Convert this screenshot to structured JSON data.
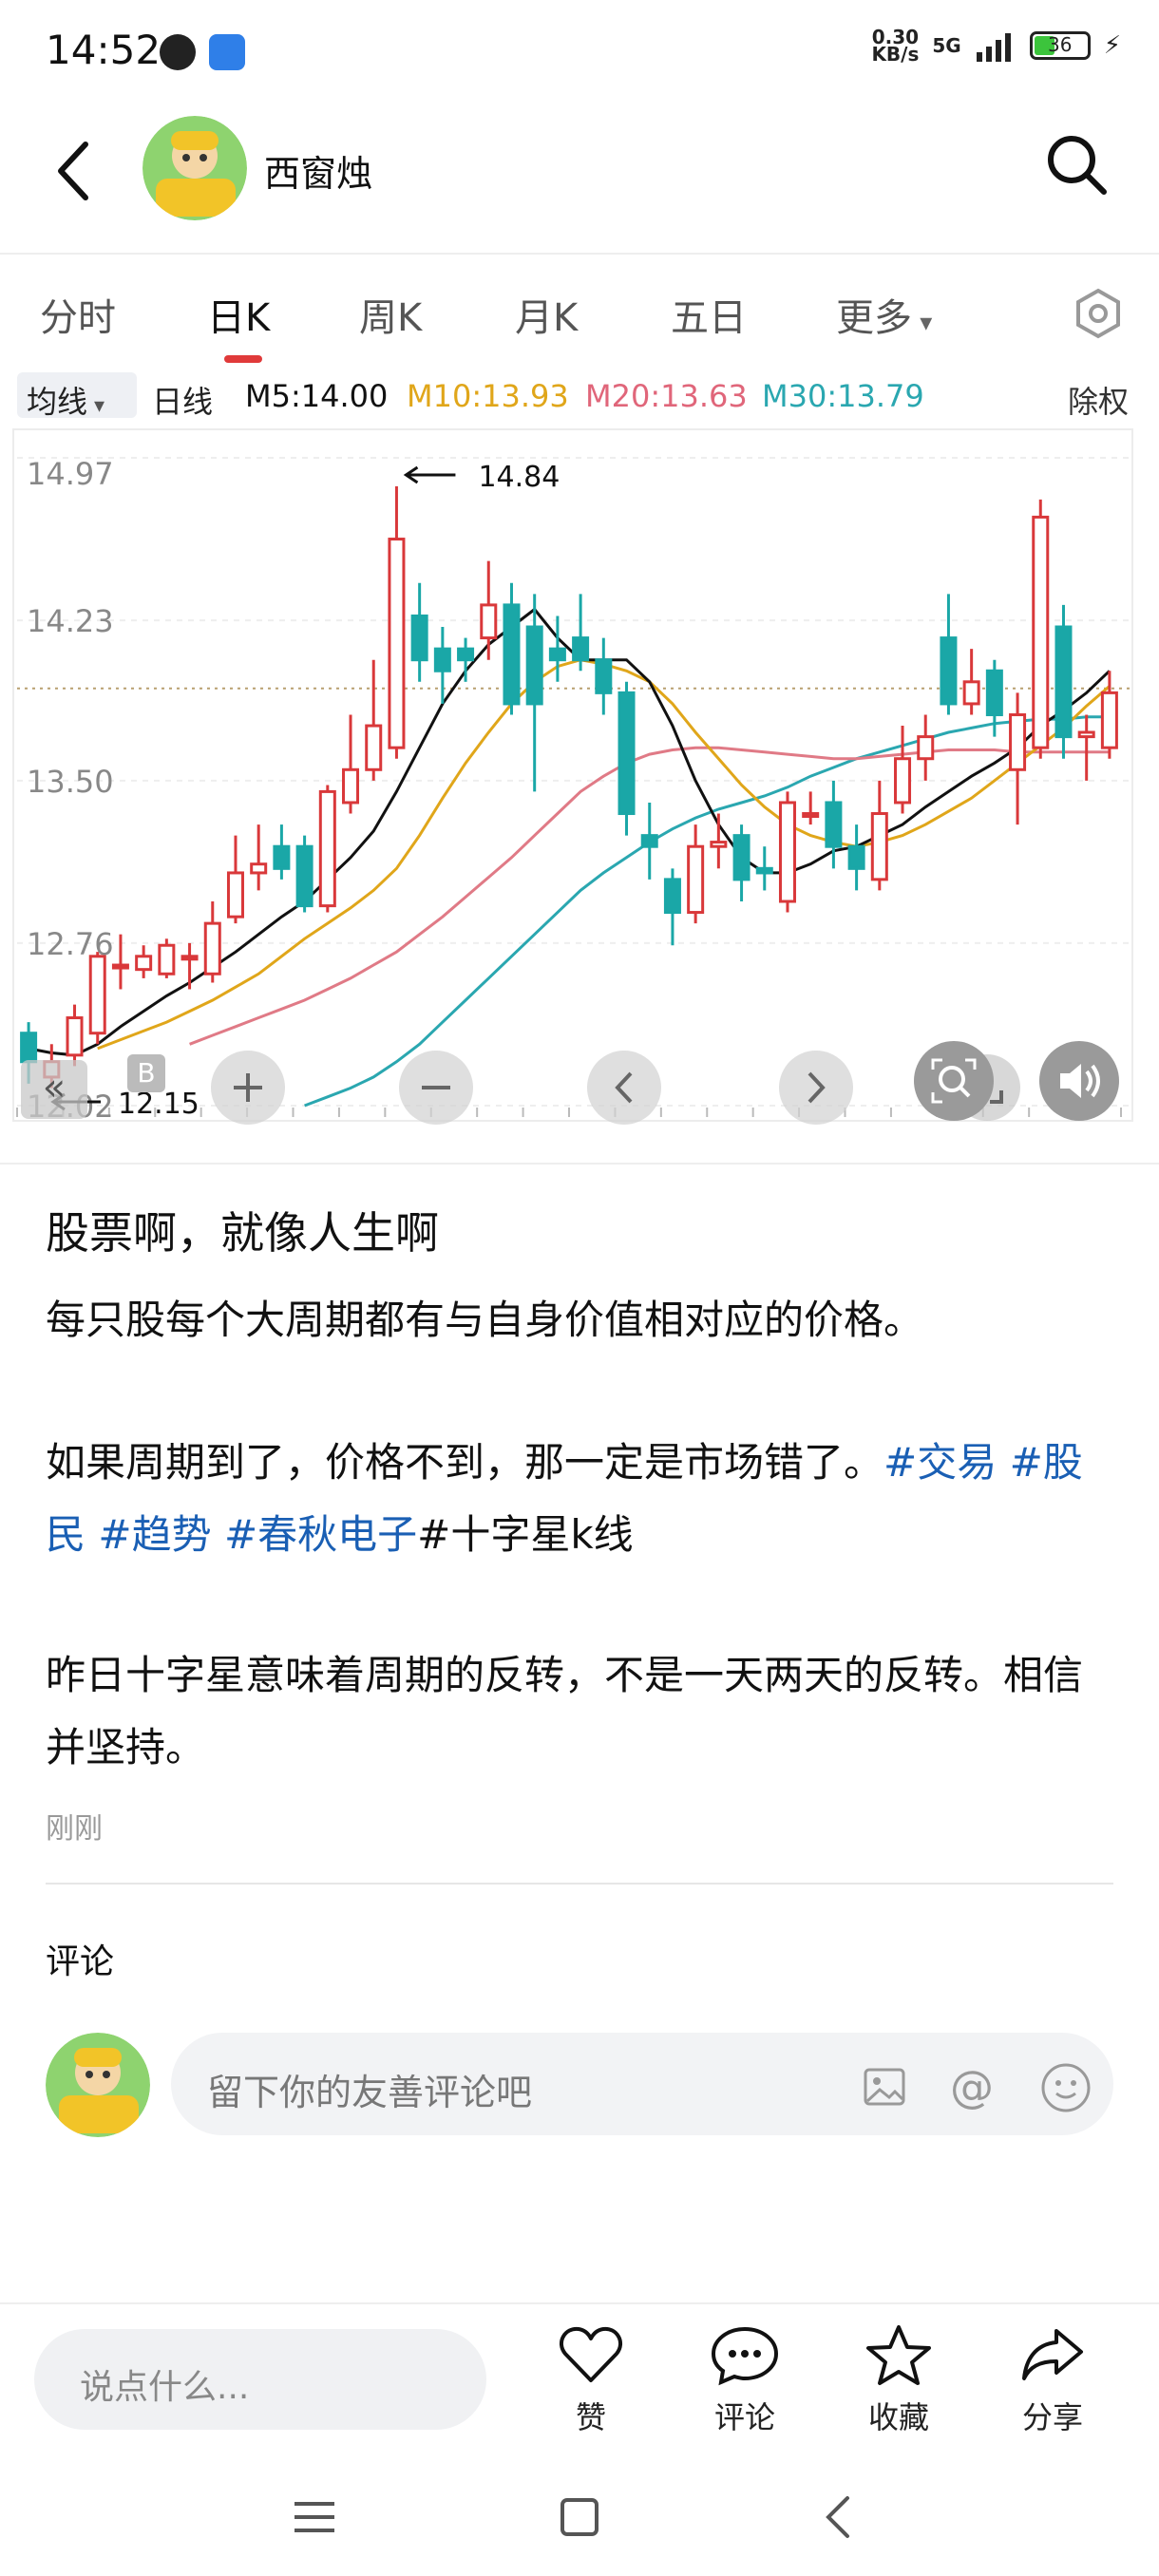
{
  "status_bar": {
    "time": "14:52",
    "net_speed_value": "0.30",
    "net_speed_unit": "KB/s",
    "network": "5G",
    "battery": "36"
  },
  "header": {
    "username": "西窗烛"
  },
  "chart_tabs": [
    "分时",
    "日K",
    "周K",
    "月K",
    "五日",
    "更多"
  ],
  "chart_legend": {
    "ma_select": "均线",
    "period": "日线",
    "m5": "M5:14.00",
    "m10": "M10:13.93",
    "m20": "M20:13.63",
    "m30": "M30:13.79",
    "adjust": "除权"
  },
  "colors": {
    "up": "#d9383a",
    "down": "#1aa7a7",
    "m5": "#111111",
    "m10": "#e0a61a",
    "m20": "#e07a86",
    "m30": "#2aa7b0",
    "link": "#1a5fb4"
  },
  "chart_data": {
    "type": "candlestick",
    "y_ticks": [
      "14.97",
      "14.23",
      "13.50",
      "12.76",
      "12.02"
    ],
    "ylim": [
      12.02,
      14.97
    ],
    "high_marker": "14.84",
    "low_marker": "12.15",
    "reference_price": 13.92,
    "candles": [
      [
        12.35,
        12.22,
        12.4,
        12.12
      ],
      [
        12.15,
        12.22,
        12.3,
        12.1
      ],
      [
        12.25,
        12.42,
        12.48,
        12.2
      ],
      [
        12.35,
        12.7,
        12.72,
        12.3
      ],
      [
        12.65,
        12.66,
        12.8,
        12.55
      ],
      [
        12.64,
        12.7,
        12.75,
        12.6
      ],
      [
        12.62,
        12.75,
        12.78,
        12.6
      ],
      [
        12.7,
        12.7,
        12.76,
        12.55
      ],
      [
        12.62,
        12.85,
        12.95,
        12.58
      ],
      [
        12.88,
        13.08,
        13.25,
        12.85
      ],
      [
        13.08,
        13.12,
        13.3,
        13.0
      ],
      [
        13.2,
        13.1,
        13.3,
        13.05
      ],
      [
        13.2,
        12.93,
        13.25,
        12.9
      ],
      [
        12.93,
        13.45,
        13.48,
        12.9
      ],
      [
        13.4,
        13.55,
        13.8,
        13.35
      ],
      [
        13.55,
        13.75,
        14.05,
        13.5
      ],
      [
        13.65,
        14.6,
        14.84,
        13.6
      ],
      [
        14.25,
        14.05,
        14.4,
        13.95
      ],
      [
        14.1,
        14.0,
        14.2,
        13.85
      ],
      [
        14.1,
        14.05,
        14.15,
        13.95
      ],
      [
        14.15,
        14.3,
        14.5,
        14.05
      ],
      [
        14.3,
        13.85,
        14.4,
        13.8
      ],
      [
        14.2,
        13.85,
        14.35,
        13.45
      ],
      [
        14.1,
        14.05,
        14.25,
        13.95
      ],
      [
        14.15,
        14.05,
        14.35,
        14.0
      ],
      [
        14.05,
        13.9,
        14.15,
        13.8
      ],
      [
        13.9,
        13.35,
        13.95,
        13.25
      ],
      [
        13.25,
        13.2,
        13.4,
        13.05
      ],
      [
        13.05,
        12.9,
        13.1,
        12.75
      ],
      [
        12.9,
        13.2,
        13.3,
        12.85
      ],
      [
        13.2,
        13.22,
        13.35,
        13.1
      ],
      [
        13.25,
        13.05,
        13.3,
        12.95
      ],
      [
        13.1,
        13.08,
        13.2,
        13.0
      ],
      [
        12.95,
        13.4,
        13.45,
        12.9
      ],
      [
        13.35,
        13.35,
        13.45,
        13.3
      ],
      [
        13.4,
        13.2,
        13.5,
        13.1
      ],
      [
        13.2,
        13.1,
        13.3,
        13.0
      ],
      [
        13.05,
        13.35,
        13.5,
        13.0
      ],
      [
        13.4,
        13.6,
        13.75,
        13.35
      ],
      [
        13.6,
        13.7,
        13.8,
        13.5
      ],
      [
        14.15,
        13.85,
        14.35,
        13.8
      ],
      [
        13.85,
        13.95,
        14.1,
        13.8
      ],
      [
        14.0,
        13.8,
        14.05,
        13.7
      ],
      [
        13.55,
        13.8,
        13.9,
        13.3
      ],
      [
        13.65,
        14.7,
        14.78,
        13.6
      ],
      [
        14.2,
        13.7,
        14.3,
        13.6
      ],
      [
        13.7,
        13.72,
        13.8,
        13.5
      ],
      [
        13.65,
        13.9,
        14.0,
        13.6
      ]
    ],
    "ma5": [
      12.28,
      12.26,
      12.25,
      12.3,
      12.38,
      12.45,
      12.52,
      12.58,
      12.65,
      12.72,
      12.8,
      12.88,
      12.95,
      13.05,
      13.15,
      13.27,
      13.45,
      13.65,
      13.85,
      14.0,
      14.12,
      14.2,
      14.28,
      14.15,
      14.05,
      14.05,
      14.05,
      13.95,
      13.75,
      13.5,
      13.3,
      13.15,
      13.08,
      13.08,
      13.12,
      13.18,
      13.2,
      13.25,
      13.3,
      13.38,
      13.45,
      13.52,
      13.58,
      13.65,
      13.75,
      13.82,
      13.9,
      14.0
    ],
    "ma10": [
      null,
      null,
      null,
      12.28,
      12.32,
      12.36,
      12.4,
      12.45,
      12.5,
      12.56,
      12.62,
      12.7,
      12.78,
      12.85,
      12.92,
      13.0,
      13.1,
      13.25,
      13.42,
      13.58,
      13.72,
      13.85,
      13.95,
      14.02,
      14.05,
      14.03,
      14.0,
      13.95,
      13.85,
      13.72,
      13.6,
      13.48,
      13.38,
      13.3,
      13.25,
      13.22,
      13.2,
      13.22,
      13.25,
      13.3,
      13.36,
      13.42,
      13.5,
      13.58,
      13.66,
      13.74,
      13.84,
      13.93
    ],
    "ma20": [
      null,
      null,
      null,
      null,
      null,
      null,
      null,
      12.3,
      12.34,
      12.38,
      12.42,
      12.46,
      12.5,
      12.55,
      12.6,
      12.66,
      12.72,
      12.8,
      12.88,
      12.97,
      13.06,
      13.15,
      13.25,
      13.35,
      13.45,
      13.52,
      13.58,
      13.62,
      13.64,
      13.65,
      13.65,
      13.64,
      13.63,
      13.62,
      13.61,
      13.6,
      13.6,
      13.61,
      13.62,
      13.63,
      13.64,
      13.64,
      13.64,
      13.63,
      13.63,
      13.63,
      13.63,
      13.63
    ],
    "ma30": [
      null,
      null,
      null,
      null,
      null,
      null,
      null,
      null,
      null,
      null,
      null,
      null,
      12.02,
      12.06,
      12.1,
      12.15,
      12.22,
      12.3,
      12.4,
      12.5,
      12.6,
      12.7,
      12.8,
      12.9,
      13.0,
      13.08,
      13.15,
      13.22,
      13.28,
      13.33,
      13.37,
      13.4,
      13.43,
      13.47,
      13.52,
      13.56,
      13.6,
      13.63,
      13.66,
      13.69,
      13.72,
      13.74,
      13.76,
      13.77,
      13.78,
      13.78,
      13.79,
      13.79
    ]
  },
  "post": {
    "title": "股票啊，就像人生啊",
    "p1": "每只股每个大周期都有与自身价值相对应的价格。",
    "p2_a": "如果周期到了，价格不到，那一定是市场错了。",
    "tag1": "#交易",
    "tag2": "#股民",
    "tag3": "#趋势",
    "tag4": "#春秋电子",
    "tag5": "#十字星k线",
    "p3": "昨日十字星意味着周期的反转，不是一天两天的反转。相信并坚持。",
    "time": "刚刚"
  },
  "comments": {
    "label": "评论",
    "placeholder": "留下你的友善评论吧"
  },
  "bottom_bar": {
    "placeholder": "说点什么...",
    "like": "赞",
    "comment": "评论",
    "favorite": "收藏",
    "share": "分享"
  }
}
